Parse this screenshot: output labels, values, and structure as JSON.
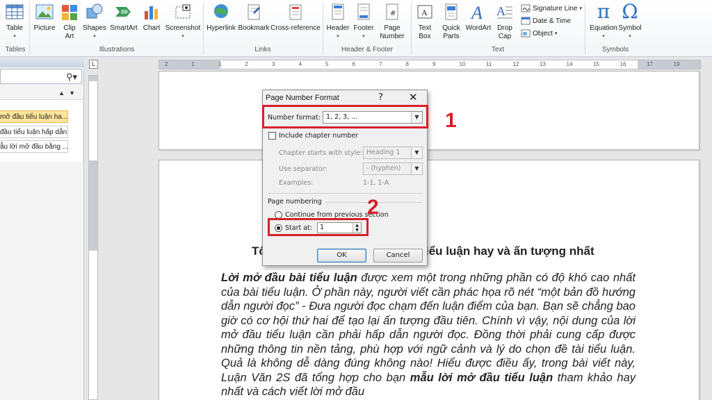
{
  "ribbon": {
    "tables": {
      "table_label": "Table",
      "group_label": "Tables"
    },
    "illustrations": {
      "picture_label": "Picture",
      "clip_art_label_1": "Clip",
      "clip_art_label_2": "Art",
      "shapes_label": "Shapes",
      "smartart_label": "SmartArt",
      "chart_label": "Chart",
      "screenshot_label": "Screenshot",
      "group_label": "Illustrations"
    },
    "links": {
      "hyperlink_label": "Hyperlink",
      "bookmark_label": "Bookmark",
      "cross_reference_label": "Cross-reference",
      "group_label": "Links"
    },
    "header_footer": {
      "header_label": "Header",
      "footer_label": "Footer",
      "page_number_label_1": "Page",
      "page_number_label_2": "Number",
      "group_label": "Header & Footer"
    },
    "text": {
      "text_box_label_1": "Text",
      "text_box_label_2": "Box",
      "quick_parts_label_1": "Quick",
      "quick_parts_label_2": "Parts",
      "wordart_label": "WordArt",
      "drop_cap_label_1": "Drop",
      "drop_cap_label_2": "Cap",
      "signature_line_label": "Signature Line",
      "date_time_label": "Date & Time",
      "object_label": "Object",
      "group_label": "Text"
    },
    "symbols": {
      "equation_label": "Equation",
      "symbol_label": "Symbol",
      "pi_glyph": "π",
      "omega_glyph": "Ω",
      "group_label": "Symbols"
    }
  },
  "nav_pane": {
    "search_icon": "search-icon",
    "items": [
      "mở đầu tiểu luận ha...",
      "đầu tiểu luận hấp dẫn",
      "ẫu lời mở đầu bằng ..."
    ]
  },
  "ruler": {
    "corner_glyph": "L",
    "numbers": [
      "2",
      "1",
      "1",
      "2",
      "3",
      "4",
      "5",
      "6",
      "7",
      "8",
      "9",
      "10",
      "11",
      "12",
      "13",
      "14",
      "15",
      "16",
      "17",
      "19"
    ]
  },
  "dialog": {
    "title": "Page Number Format",
    "help_glyph": "?",
    "close_glyph": "✕",
    "number_format_label": "Number format:",
    "number_format_value": "1, 2, 3, ...",
    "include_chapter_label": "Include chapter number",
    "chapter_starts_label": "Chapter starts with style:",
    "chapter_starts_value": "Heading 1",
    "use_separator_label": "Use separator:",
    "use_separator_value": "-   (hyphen)",
    "examples_label": "Examples:",
    "examples_value": "1-1, 1-A",
    "page_numbering_label": "Page numbering",
    "continue_label": "Continue from previous section",
    "start_at_label": "Start at:",
    "start_at_value": "1",
    "ok_label": "OK",
    "cancel_label": "Cancel"
  },
  "annotations": {
    "marker_1": "1",
    "marker_2": "2",
    "color": "#d6202a"
  },
  "document": {
    "heading_left": "Tổ",
    "heading_right": "iểu luận hay và ấn tượng nhất",
    "body_bold_1": "Lời mở đầu bài tiểu luận",
    "body_text_1": " được xem một trong những phần có độ khó cao nhất của bài tiểu luận. Ở phần này, người viết cần phác họa rõ nét “một bản đồ hướng dẫn người đọc” - Đưa người đọc chạm đến luận điểm của bạn. Bạn sẽ chẳng bao giờ có cơ hội thứ hai để tạo lại ấn tượng đầu tiên. Chính vì vậy, nội dung của lời mở đầu tiểu luận cần phải hấp dẫn người đọc. Đồng thời phải cung cấp được những thông tin nền tảng, phù hợp với ngữ cảnh và lý do chọn đề tài tiểu luận. Quả là không dễ dàng đúng không nào! Hiểu được điều ấy, trong bài viết này, Luận Văn 2S đã tổng hợp cho bạn ",
    "body_bold_2": "mẫu lời mở đầu tiểu luận",
    "body_text_2": " tham khảo hay nhất và cách viết lời mở đầu"
  }
}
